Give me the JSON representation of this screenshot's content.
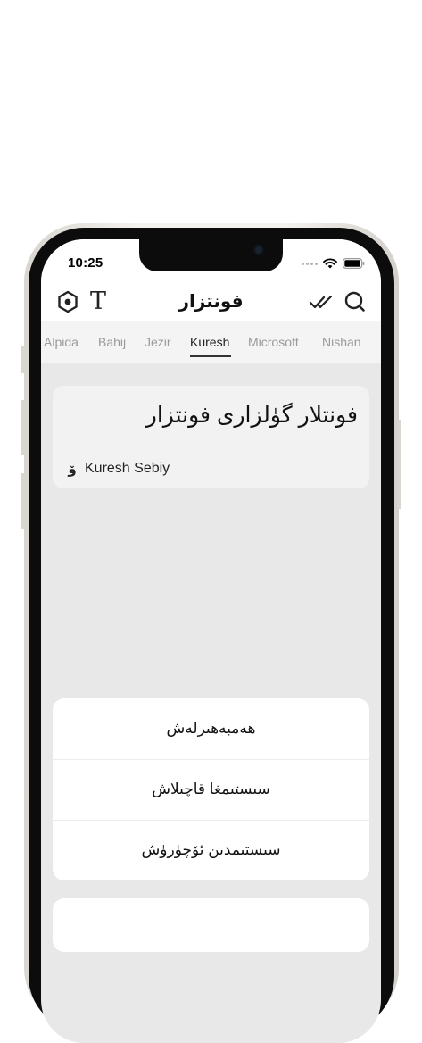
{
  "status_bar": {
    "time": "10:25"
  },
  "nav": {
    "title": "فونتزار",
    "left_icons": [
      "hexagon-icon",
      "text-t-icon"
    ],
    "right_icons": [
      "double-check-icon",
      "search-icon"
    ]
  },
  "tabs": {
    "items": [
      {
        "label": "Alpida"
      },
      {
        "label": "Bahij"
      },
      {
        "label": "Jezir"
      },
      {
        "label": "Kuresh"
      },
      {
        "label": "Microsoft"
      },
      {
        "label": "Nishan"
      }
    ],
    "active": "Kuresh"
  },
  "font_card": {
    "sample_text": "فونتلار گۈلزارى فونتزار",
    "author_icon_glyph": "ﯙ",
    "author": "Kuresh Sebiy"
  },
  "action_sheet": {
    "items": [
      {
        "label": "ھەمبەھىرلەش"
      },
      {
        "label": "سىستىمغا قاچىلاش"
      },
      {
        "label": "سىستىمدىن ئۆچۈرۈش"
      }
    ]
  },
  "colors": {
    "screen_background": "#e8e8e8",
    "card_background": "#f2f2f2",
    "active_tab": "#222222",
    "inactive_tab": "#9a9a9a"
  }
}
